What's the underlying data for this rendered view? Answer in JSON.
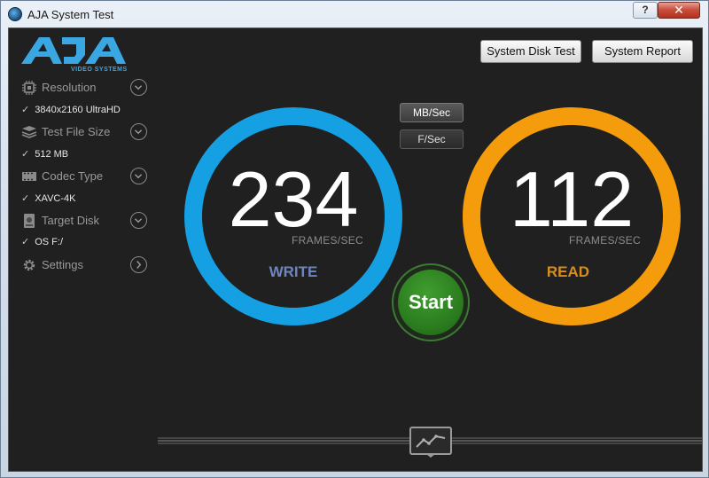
{
  "window": {
    "title": "AJA System Test",
    "help_label": "?",
    "close_label": "✕"
  },
  "logo": {
    "brand": "AJA",
    "tagline": "VIDEO SYSTEMS"
  },
  "toolbar": {
    "disk_test_label": "System Disk Test",
    "report_label": "System Report"
  },
  "sidebar": {
    "items": [
      {
        "label": "Resolution",
        "value": "3840x2160 UltraHD",
        "icon": "resolution-chip-icon"
      },
      {
        "label": "Test File Size",
        "value": "512 MB",
        "icon": "file-stack-icon"
      },
      {
        "label": "Codec Type",
        "value": "XAVC-4K",
        "icon": "film-strip-icon"
      },
      {
        "label": "Target Disk",
        "value": "OS F:/",
        "icon": "disk-drive-icon"
      },
      {
        "label": "Settings",
        "icon": "gear-icon"
      }
    ]
  },
  "rate": {
    "mb_label": "MB/Sec",
    "fps_label": "F/Sec",
    "selected": "MB/Sec"
  },
  "write": {
    "value": "234",
    "unit": "FRAMES/SEC",
    "label": "WRITE",
    "color": "#14a0e3",
    "label_color": "#6d86bd"
  },
  "read": {
    "value": "112",
    "unit": "FRAMES/SEC",
    "label": "READ",
    "color": "#f59c0c",
    "label_color": "#d88e1c"
  },
  "start": {
    "label": "Start"
  },
  "bottom": {
    "graph_icon": "line-graph-icon"
  }
}
